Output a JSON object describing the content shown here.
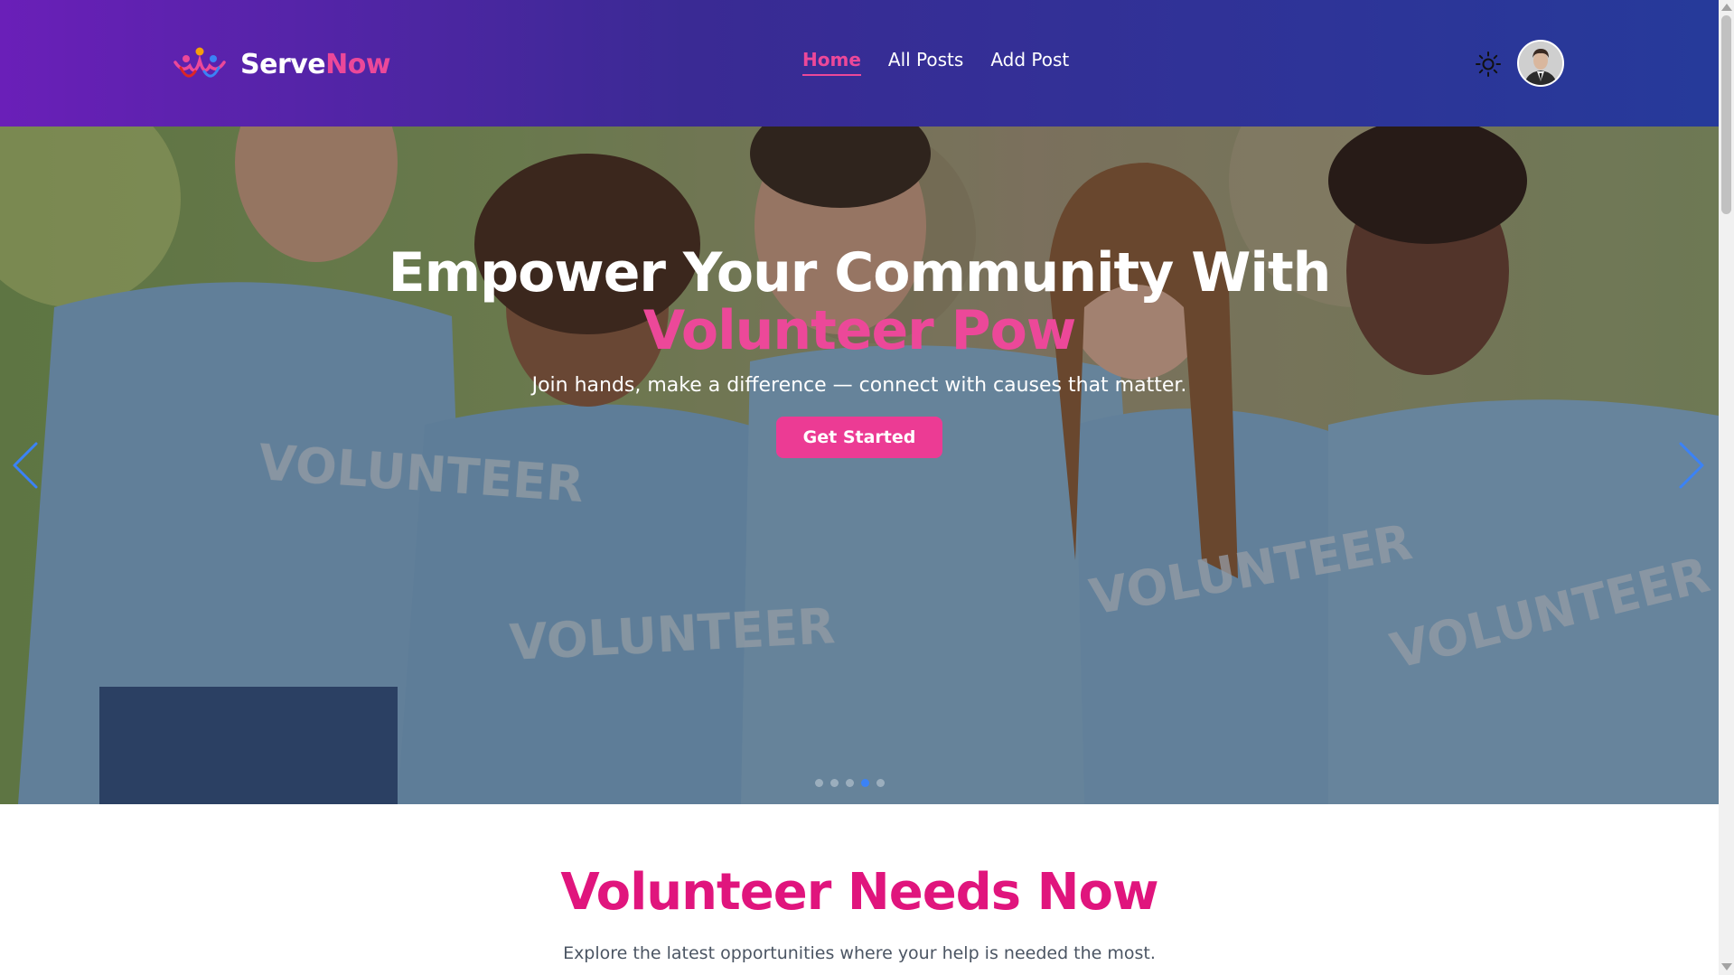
{
  "brand": {
    "name_part1": "Serve",
    "name_part2": "Now",
    "logo_icon": "people-logo-icon"
  },
  "nav": {
    "items": [
      {
        "label": "Home",
        "active": true
      },
      {
        "label": "All Posts",
        "active": false
      },
      {
        "label": "Add Post",
        "active": false
      }
    ]
  },
  "header": {
    "theme_icon": "sun-icon",
    "avatar_icon": "user-avatar"
  },
  "hero": {
    "title_line1": "Empower Your Community With",
    "title_line2": "Volunteer Pow",
    "subtitle": "Join hands, make a difference — connect with causes that matter.",
    "cta_label": "Get Started",
    "shirt_text": "VOLUNTEER",
    "prev_icon": "chevron-left-icon",
    "next_icon": "chevron-right-icon",
    "slide_count": 5,
    "active_slide": 3
  },
  "section": {
    "title": "Volunteer Needs Now",
    "subtitle": "Explore the latest opportunities where your help is needed the most."
  },
  "colors": {
    "accent": "#ec4899",
    "cta": "#ec3b94",
    "section_title": "#e0157d",
    "nav_gradient_start": "#6a1fb8",
    "nav_gradient_end": "#263a9a",
    "dot_active": "#3b82f6"
  }
}
